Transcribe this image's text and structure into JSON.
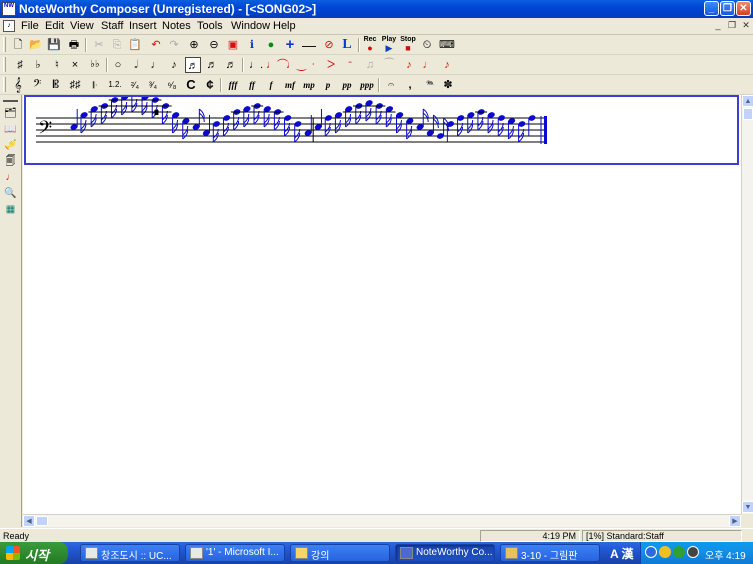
{
  "window": {
    "title": "NoteWorthy Composer (Unregistered) - [<SONG02>]",
    "app_icon": "NW",
    "caption_buttons": [
      "_",
      "❐",
      "✕"
    ]
  },
  "menubar": {
    "items": [
      "File",
      "Edit",
      "View",
      "Staff",
      "Insert",
      "Notes",
      "Tools",
      "Window",
      "Help"
    ],
    "mdi_buttons": [
      "_",
      "❐",
      "✕"
    ]
  },
  "toolbar1": {
    "icons": [
      "new-icon",
      "open-icon",
      "save-icon",
      "print-icon",
      "cut-icon",
      "copy-icon",
      "paste-icon",
      "undo-icon",
      "redo-icon",
      "zoom-in-icon",
      "zoom-out-icon",
      "find-icon",
      "info-icon",
      "globe-icon",
      "add-icon",
      "remove-icon",
      "no-icon",
      "lyrics-icon",
      "record-icon",
      "play-icon",
      "stop-icon",
      "metronome-icon",
      "keyboard-icon"
    ],
    "rec_label": "Rec",
    "play_label": "Play",
    "stop_label": "Stop",
    "lyrics_glyph": "L"
  },
  "toolbar2": {
    "sharp": "♯",
    "flat": "♭",
    "double_sharp": "×",
    "double_flat": "♭♭",
    "durations": [
      "𝅝",
      "𝅗𝅥",
      "♩",
      "♪",
      "♬",
      "𝅘𝅥𝅯",
      "𝅘𝅥𝅰"
    ]
  },
  "toolbar3": {
    "dynamics": [
      "fff",
      "ff",
      "f",
      "mf",
      "mp",
      "p",
      "pp",
      "ppp"
    ],
    "time_sigs": [
      "C",
      "¢"
    ],
    "endings": "1.2."
  },
  "score": {
    "clef": "bass",
    "notes": [
      {
        "pitch": 5,
        "duration": "quarter"
      },
      {
        "pitch": 9,
        "duration": "sixteenth"
      },
      {
        "pitch": 11,
        "duration": "sixteenth"
      },
      {
        "pitch": 12,
        "duration": "sixteenth"
      },
      {
        "pitch": 14,
        "duration": "sixteenth"
      },
      {
        "pitch": 15,
        "duration": "sixteenth"
      },
      {
        "pitch": 16,
        "duration": "sixteenth"
      },
      {
        "pitch": 15,
        "duration": "sixteenth"
      },
      {
        "pitch": 14,
        "duration": "sixteenth"
      },
      {
        "pitch": 12,
        "duration": "sixteenth"
      },
      {
        "pitch": 9,
        "duration": "sixteenth"
      },
      {
        "pitch": 7,
        "duration": "sixteenth"
      },
      {
        "pitch": 5,
        "duration": "sixteenth"
      },
      {
        "pitch": 3,
        "duration": "quarter"
      },
      {
        "pitch": 6,
        "duration": "sixteenth"
      },
      {
        "pitch": 8,
        "duration": "sixteenth"
      },
      {
        "pitch": 10,
        "duration": "sixteenth"
      },
      {
        "pitch": 11,
        "duration": "sixteenth"
      },
      {
        "pitch": 12,
        "duration": "sixteenth"
      },
      {
        "pitch": 11,
        "duration": "sixteenth"
      },
      {
        "pitch": 10,
        "duration": "sixteenth"
      },
      {
        "pitch": 8,
        "duration": "sixteenth"
      },
      {
        "pitch": 6,
        "duration": "sixteenth"
      },
      {
        "pitch": 3,
        "duration": "quarter"
      },
      {
        "pitch": 5,
        "duration": "quarter"
      },
      {
        "pitch": 8,
        "duration": "sixteenth"
      },
      {
        "pitch": 9,
        "duration": "sixteenth"
      },
      {
        "pitch": 11,
        "duration": "sixteenth"
      },
      {
        "pitch": 12,
        "duration": "sixteenth"
      },
      {
        "pitch": 13,
        "duration": "sixteenth"
      },
      {
        "pitch": 12,
        "duration": "sixteenth"
      },
      {
        "pitch": 11,
        "duration": "sixteenth"
      },
      {
        "pitch": 9,
        "duration": "sixteenth"
      },
      {
        "pitch": 7,
        "duration": "sixteenth"
      },
      {
        "pitch": 5,
        "duration": "sixteenth"
      },
      {
        "pitch": 3,
        "duration": "sixteenth"
      },
      {
        "pitch": 2,
        "duration": "sixteenth"
      },
      {
        "pitch": 6,
        "duration": "quarter"
      },
      {
        "pitch": 8,
        "duration": "sixteenth"
      },
      {
        "pitch": 9,
        "duration": "sixteenth"
      },
      {
        "pitch": 10,
        "duration": "sixteenth"
      },
      {
        "pitch": 9,
        "duration": "sixteenth"
      },
      {
        "pitch": 8,
        "duration": "sixteenth"
      },
      {
        "pitch": 7,
        "duration": "sixteenth"
      },
      {
        "pitch": 6,
        "duration": "sixteenth"
      },
      {
        "pitch": 8,
        "duration": "quarter"
      }
    ]
  },
  "statusbar": {
    "status": "Ready",
    "time": "4:19 PM",
    "zoom_staff": "[1%] Standard:Staff"
  },
  "taskbar": {
    "start_label": "시작",
    "tasks": [
      {
        "label": "창조도시 :: UC...",
        "active": false
      },
      {
        "label": "'1' - Microsoft I...",
        "active": false
      },
      {
        "label": "강의",
        "active": false
      },
      {
        "label": "NoteWorthy Co...",
        "active": true
      },
      {
        "label": "3-10 - 그림판",
        "active": false
      }
    ],
    "ime": "A 漢",
    "clock": "오후 4:19"
  }
}
